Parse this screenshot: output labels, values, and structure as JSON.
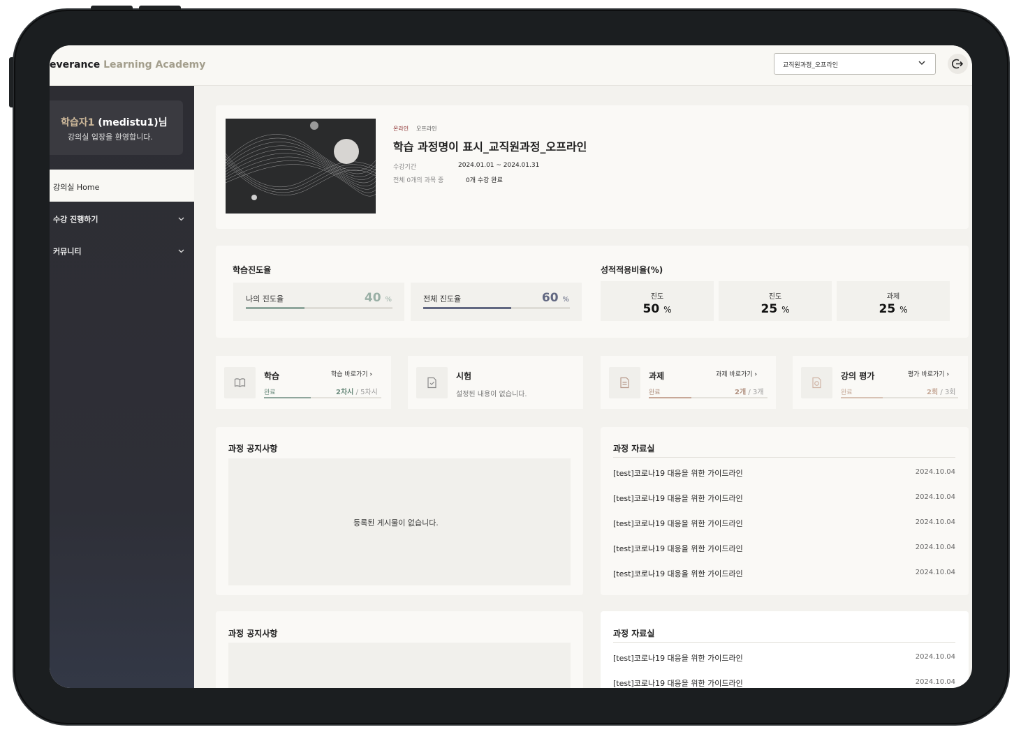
{
  "app": {
    "brand_main": "everance",
    "brand_sub": "Learning Academy",
    "course_select": "교직원과정_오프라인"
  },
  "sidebar": {
    "user_name": "학습자1",
    "user_id": "(medistu1)님",
    "greeting": "강의실 입장을 환영합니다.",
    "items": [
      {
        "label": "강의실 Home"
      },
      {
        "label": "수강 진행하기"
      },
      {
        "label": "커뮤니티"
      }
    ]
  },
  "course": {
    "tag_online": "온라인",
    "tag_offline": "오프라인",
    "title": "학습 과정명이 표시_교직원과정_오프라인",
    "period_label": "수강기간",
    "period_value": "2024.01.01 ~ 2024.01.31",
    "count_label": "전체 0개의 과목 중",
    "count_value": "0개 수강 완료"
  },
  "progress": {
    "title": "학습진도율",
    "mine_label": "나의 진도율",
    "mine_value": "40",
    "mine_unit": "%",
    "mine_fraction": 0.4,
    "all_label": "전체 진도율",
    "all_value": "60",
    "all_unit": "%",
    "all_fraction": 0.6
  },
  "grade": {
    "title": "성적적용비율(%)",
    "items": [
      {
        "label": "진도",
        "value": "50",
        "unit": "%"
      },
      {
        "label": "진도",
        "value": "25",
        "unit": "%"
      },
      {
        "label": "과제",
        "value": "25",
        "unit": "%"
      }
    ]
  },
  "summary": {
    "study": {
      "title": "학습",
      "link": "학습 바로가기",
      "status": "완료",
      "done": "2차시",
      "total": "/ 5차시",
      "fraction": 0.4
    },
    "exam": {
      "title": "시험",
      "message": "설정된 내용이 없습니다."
    },
    "task": {
      "title": "과제",
      "link": "과제 바로가기",
      "status": "완료",
      "done": "2개",
      "total": "/ 3개",
      "fraction": 0.36
    },
    "eval": {
      "title": "강의 평가",
      "link": "평가 바로가기",
      "status": "완료",
      "done": "2회",
      "total": "/ 3회",
      "fraction": 0.36
    }
  },
  "notice": {
    "title": "과정 공지사항",
    "empty": "등록된 게시물이 없습니다.",
    "title2": "과정 공지사항"
  },
  "archive": {
    "title": "과정 자료실",
    "rows": [
      {
        "title": "[test]코로나19 대응을 위한 가이드라인",
        "date": "2024.10.04"
      },
      {
        "title": "[test]코로나19 대응을 위한 가이드라인",
        "date": "2024.10.04"
      },
      {
        "title": "[test]코로나19 대응을 위한 가이드라인",
        "date": "2024.10.04"
      },
      {
        "title": "[test]코로나19 대응을 위한 가이드라인",
        "date": "2024.10.04"
      },
      {
        "title": "[test]코로나19 대응을 위한 가이드라인",
        "date": "2024.10.04"
      }
    ],
    "title2": "과정 자료실",
    "rows2": [
      {
        "title": "[test]코로나19 대응을 위한 가이드라인",
        "date": "2024.10.04"
      },
      {
        "title": "[test]코로나19 대응을 위한 가이드라인",
        "date": "2024.10.04"
      }
    ]
  },
  "colors": {
    "accent_gold": "#cdb89a",
    "tag_red": "#8a2b2b",
    "progress_mine": "#8fa69c",
    "progress_all": "#616781",
    "bar_study": "#8fa69c",
    "bar_task": "#c8a898",
    "bar_eval": "#d8c2b4"
  }
}
